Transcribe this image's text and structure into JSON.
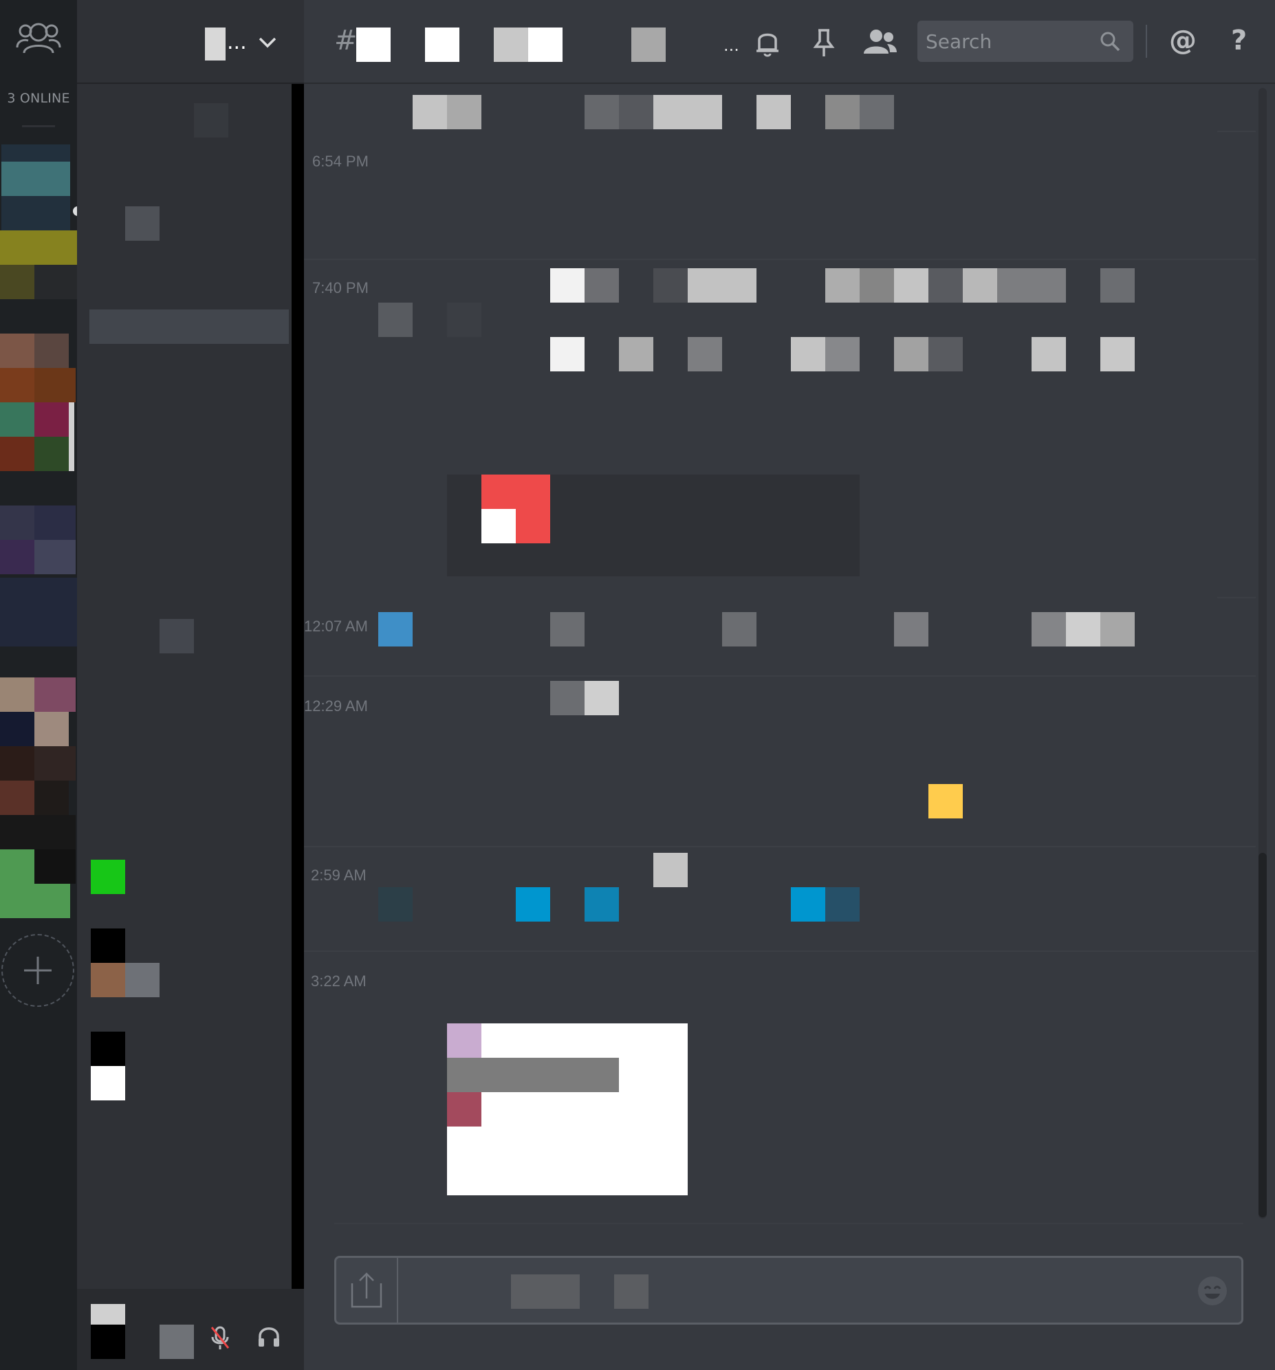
{
  "rail": {
    "online_label": "3 ONLINE"
  },
  "sidebar": {
    "header_suffix": "..."
  },
  "topbar": {
    "hash": "#",
    "ellipsis": "...",
    "search_placeholder": "Search",
    "mention_symbol": "@",
    "help_symbol": "?"
  },
  "messages": {
    "timestamps": [
      "6:54 PM",
      "7:40 PM",
      "12:07 AM",
      "12:29 AM",
      "2:59 AM",
      "3:22 AM"
    ]
  },
  "icons": {
    "friends": "friends-icon",
    "bell": "bell-icon",
    "pin": "pin-icon",
    "members": "members-icon",
    "search": "search-icon",
    "upload": "upload-icon",
    "emoji": "emoji-icon",
    "mute": "mic-muted-icon",
    "headphones": "headphones-icon",
    "add": "plus-icon",
    "chevron": "chevron-down-icon"
  },
  "colors": {
    "background": "#36393f",
    "sidebar": "#2f3136",
    "rail": "#1e2124",
    "accent_red": "#f04747",
    "online_green": "#17c617",
    "star_yellow": "#ffcc4d",
    "link_blue": "#0096cf"
  }
}
